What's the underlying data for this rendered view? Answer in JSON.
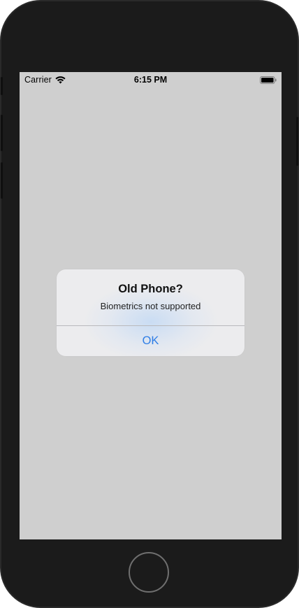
{
  "status_bar": {
    "carrier": "Carrier",
    "time": "6:15 PM",
    "wifi_icon": "wifi-icon",
    "battery_icon": "battery-icon"
  },
  "alert": {
    "title": "Old Phone?",
    "message": "Biometrics not supported",
    "ok_label": "OK"
  },
  "colors": {
    "screen_background": "#cfcfcf",
    "device_frame": "#1b1b1b",
    "alert_background": "#ececee",
    "button_tint": "#2f7ee6"
  }
}
